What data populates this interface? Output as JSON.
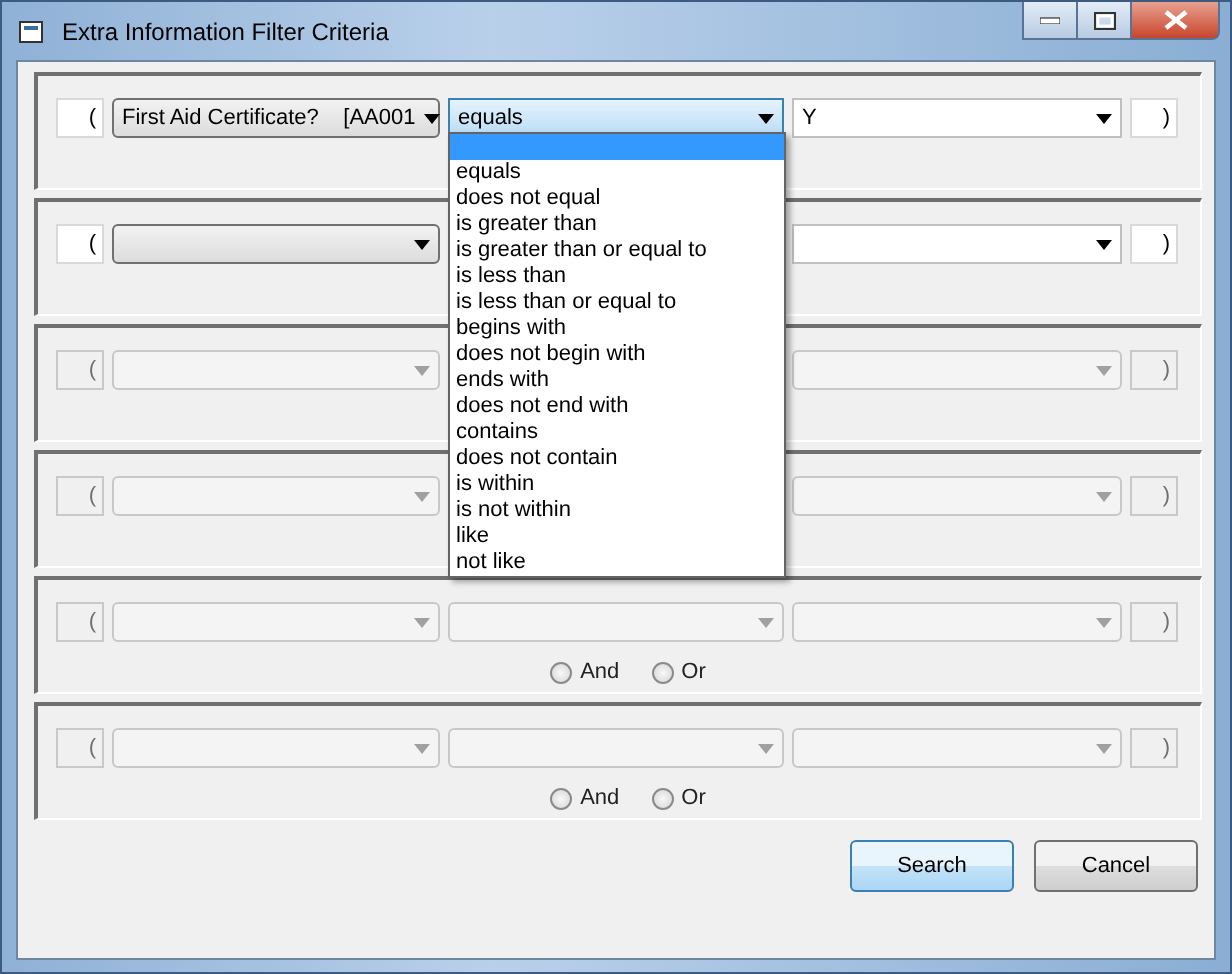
{
  "window": {
    "title": "Extra Information Filter Criteria"
  },
  "rows": [
    {
      "enabled": true,
      "open": "(",
      "field": "First Aid Certificate?    [AA001",
      "operator": "equals",
      "operator_focused": true,
      "value": "Y",
      "close": ")"
    },
    {
      "enabled": true,
      "open": "(",
      "close": ")"
    },
    {
      "enabled": false,
      "open": "(",
      "close": ")"
    },
    {
      "enabled": false,
      "open": "(",
      "close": ")"
    },
    {
      "enabled": false,
      "open": "(",
      "close": ")",
      "operator_shown": true,
      "radios": [
        {
          "label": "And",
          "checked": false
        },
        {
          "label": "Or",
          "checked": false
        }
      ]
    },
    {
      "enabled": false,
      "open": "(",
      "close": ")",
      "operator_shown": true,
      "radios": [
        {
          "label": "And",
          "checked": false
        },
        {
          "label": "Or",
          "checked": false
        }
      ]
    }
  ],
  "dropdown": {
    "items": [
      {
        "selected": true
      },
      {
        "label": "equals",
        "selected": false
      },
      {
        "label": "does not equal",
        "selected": false
      },
      {
        "label": "is greater than",
        "selected": false
      },
      {
        "label": "is greater than or equal to",
        "selected": false
      },
      {
        "label": "is less than",
        "selected": false
      },
      {
        "label": "is less than or equal to",
        "selected": false
      },
      {
        "label": "begins with",
        "selected": false
      },
      {
        "label": "does not begin with",
        "selected": false
      },
      {
        "label": "ends with",
        "selected": false
      },
      {
        "label": "does not end with",
        "selected": false
      },
      {
        "label": "contains",
        "selected": false
      },
      {
        "label": "does not contain",
        "selected": false
      },
      {
        "label": "is within",
        "selected": false
      },
      {
        "label": "is not within",
        "selected": false
      },
      {
        "label": "like",
        "selected": false
      },
      {
        "label": "not like",
        "selected": false
      }
    ]
  },
  "buttons": [
    {
      "label": "Search",
      "kind": "default"
    },
    {
      "label": "Cancel",
      "kind": "normal"
    }
  ]
}
